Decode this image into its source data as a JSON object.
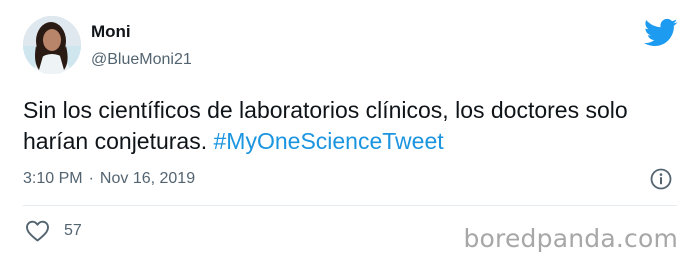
{
  "author": {
    "display_name": "Moni",
    "handle": "@BlueMoni21"
  },
  "tweet": {
    "text": "Sin los científicos de laboratorios clínicos, los doctores solo harían conjeturas. ",
    "hashtag": "#MyOneScienceTweet"
  },
  "meta": {
    "time": "3:10 PM",
    "separator": "·",
    "date": "Nov 16, 2019"
  },
  "actions": {
    "like_count": "57"
  },
  "watermark": "boredpanda.com",
  "colors": {
    "brand_blue": "#1d9bf0",
    "link": "#1b95e0",
    "secondary_text": "#536471"
  },
  "icons": [
    "twitter-bird-icon",
    "info-icon",
    "heart-icon"
  ]
}
